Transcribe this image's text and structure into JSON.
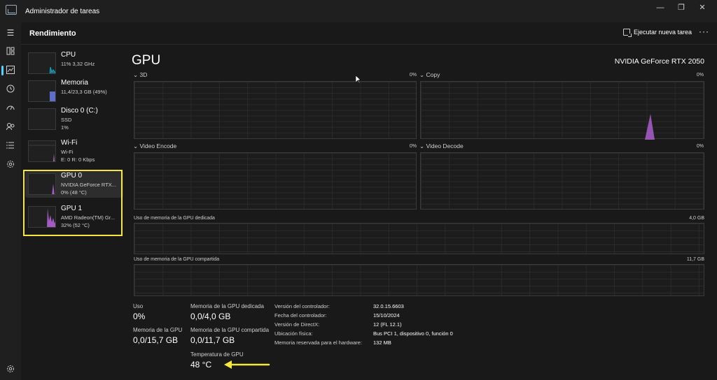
{
  "window": {
    "title": "Administrador de tareas",
    "controls": {
      "minimize": "—",
      "restore": "❐",
      "close": "✕"
    }
  },
  "header": {
    "title": "Rendimiento",
    "run_task_label": "Ejecutar nueva tarea",
    "more_label": "···"
  },
  "rail": {
    "items": [
      "menu-icon",
      "processes-icon",
      "performance-icon",
      "history-icon",
      "startup-icon",
      "users-icon",
      "details-icon",
      "services-icon",
      "settings-icon"
    ],
    "active": "performance-icon"
  },
  "devices": [
    {
      "name": "CPU",
      "sub1": "11%  3,32 GHz",
      "sub2": "",
      "color": "#17a9c4"
    },
    {
      "name": "Memoria",
      "sub1": "11,4/23,3 GB (49%)",
      "sub2": "",
      "color": "#6b7ee8"
    },
    {
      "name": "Disco 0 (C:)",
      "sub1": "SSD",
      "sub2": "1%",
      "color": "#7cc36e"
    },
    {
      "name": "Wi-Fi",
      "sub1": "Wi-Fi",
      "sub2": "E: 0  R: 0 Kbps",
      "color": "#c77dcf"
    },
    {
      "name": "GPU 0",
      "sub1": "NVIDIA GeForce RTX...",
      "sub2": "0%  (48 °C)",
      "color": "#a45bc2"
    },
    {
      "name": "GPU 1",
      "sub1": "AMD Radeon(TM) Gr...",
      "sub2": "32%  (52 °C)",
      "color": "#a45bc2"
    }
  ],
  "selected_device": "GPU 0",
  "gpu": {
    "title": "GPU",
    "device_name": "NVIDIA GeForce RTX 2050",
    "engines": [
      {
        "label": "3D",
        "pct": "0%"
      },
      {
        "label": "Copy",
        "pct": "0%"
      },
      {
        "label": "Video Encode",
        "pct": "0%"
      },
      {
        "label": "Video Decode",
        "pct": "0%"
      }
    ],
    "dedicated_mem_label": "Uso de memoria de la GPU dedicada",
    "dedicated_mem_max": "4,0 GB",
    "shared_mem_label": "Uso de memoria de la GPU compartida",
    "shared_mem_max": "11,7 GB",
    "stats": {
      "uso_label": "Uso",
      "uso_value": "0%",
      "dedicada_label": "Memoria de la GPU dedicada",
      "dedicada_value": "0,0/4,0 GB",
      "gpu_mem_label": "Memoria de la GPU",
      "gpu_mem_value": "0,0/15,7 GB",
      "compartida_label": "Memoria de la GPU compartida",
      "compartida_value": "0,0/11,7 GB",
      "temp_label": "Temperatura de GPU",
      "temp_value": "48 °C"
    },
    "info": [
      {
        "key": "Versión del controlador:",
        "value": "32.0.15.6603"
      },
      {
        "key": "Fecha del controlador:",
        "value": "15/10/2024"
      },
      {
        "key": "Versión de DirectX:",
        "value": "12 (FL 12.1)"
      },
      {
        "key": "Ubicación física:",
        "value": "Bus PCI 1, dispositivo 0, función 0"
      },
      {
        "key": "Memoria reservada para el hardware:",
        "value": "132 MB"
      }
    ]
  },
  "colors": {
    "accent": "#60cdff",
    "gpu_fill": "#a45bc2",
    "highlight": "#f5e642",
    "arrow": "#f5e642"
  }
}
